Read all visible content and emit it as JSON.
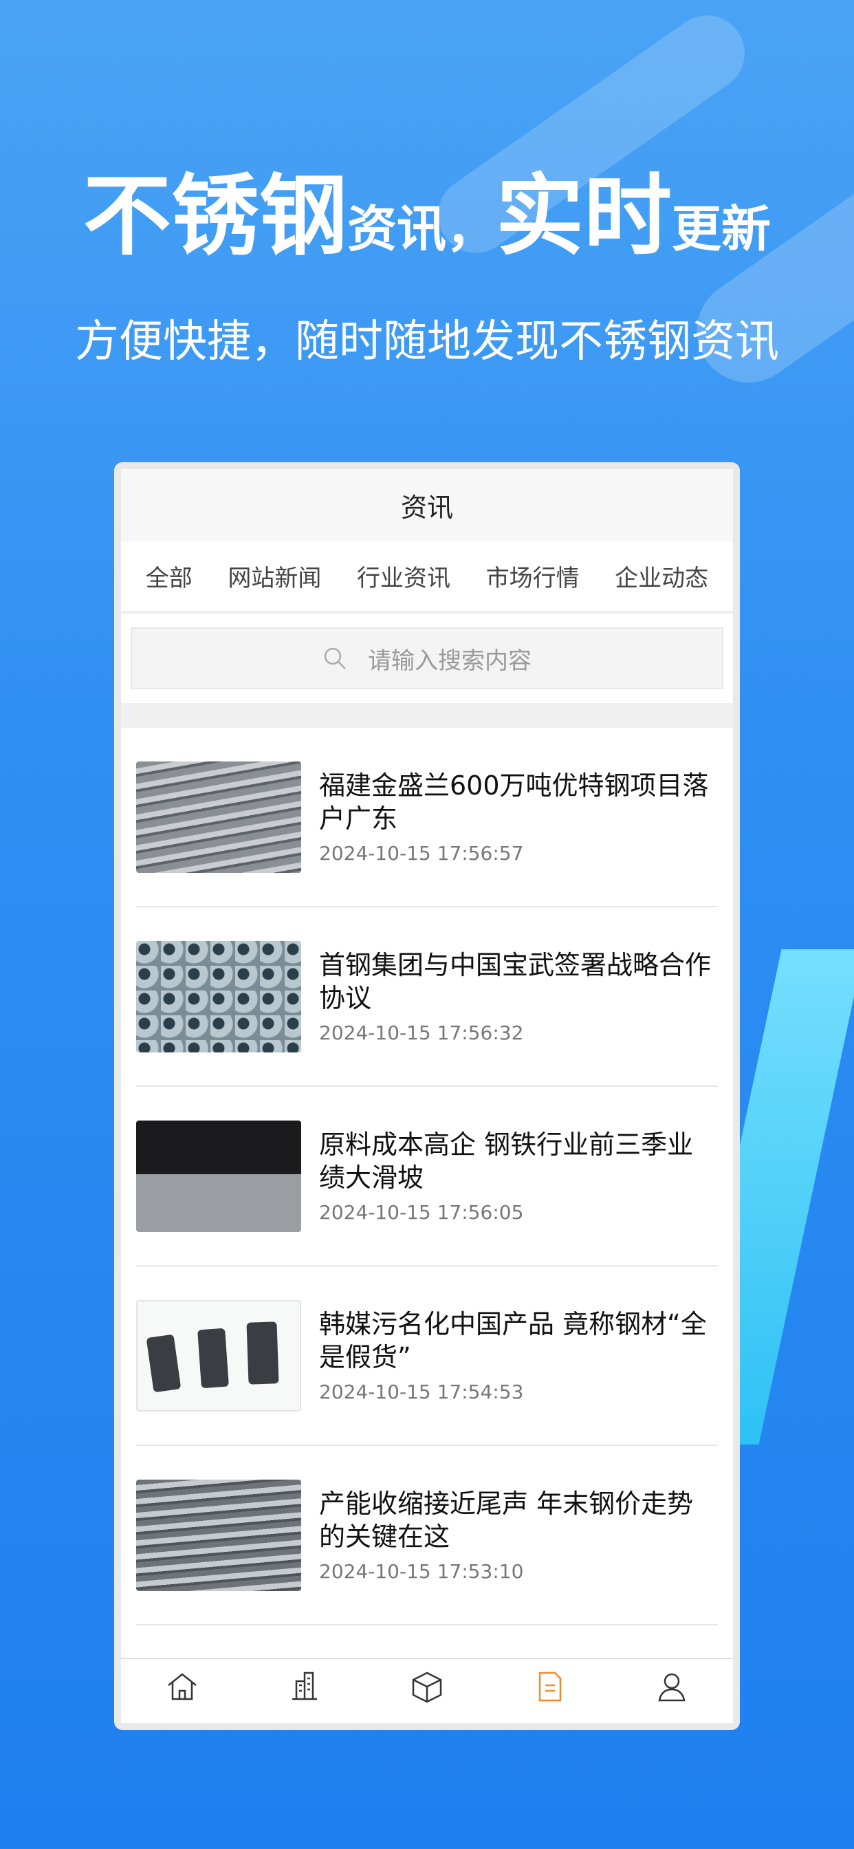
{
  "hero": {
    "title_part1": "不锈钢",
    "title_part2": "资讯，",
    "title_part3": "实时",
    "title_part4": "更新",
    "subtitle": "方便快捷，随时随地发现不锈钢资讯"
  },
  "app": {
    "title": "资讯",
    "tabs": [
      "全部",
      "网站新闻",
      "行业资讯",
      "市场行情",
      "企业动态"
    ],
    "search_placeholder": "请输入搜索内容",
    "news": [
      {
        "title": "福建金盛兰600万吨优特钢项目落户广东",
        "time": "2024-10-15 17:56:57"
      },
      {
        "title": "首钢集团与中国宝武签署战略合作协议",
        "time": "2024-10-15 17:56:32"
      },
      {
        "title": "原料成本高企 钢铁行业前三季业绩大滑坡",
        "time": "2024-10-15 17:56:05"
      },
      {
        "title": "韩媒污名化中国产品 竟称钢材“全是假货”",
        "time": "2024-10-15 17:54:53"
      },
      {
        "title": "产能收缩接近尾声 年末钢价走势的关键在这",
        "time": "2024-10-15 17:53:10"
      }
    ],
    "nav_icons": [
      "home-icon",
      "building-icon",
      "box-icon",
      "document-icon",
      "user-icon"
    ],
    "accent_color": "#f08a2a"
  }
}
